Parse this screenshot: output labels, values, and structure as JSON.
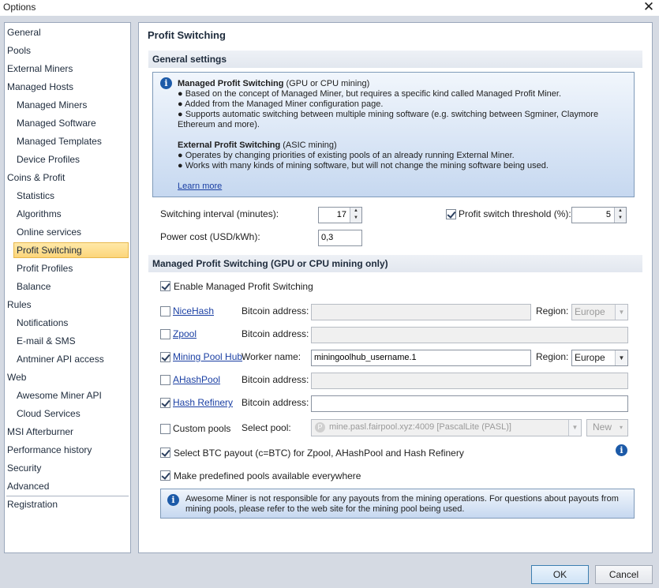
{
  "window": {
    "title": "Options",
    "close_glyph": "✕"
  },
  "sidebar": {
    "items": [
      {
        "label": "General"
      },
      {
        "label": "Pools"
      },
      {
        "label": "External Miners"
      },
      {
        "label": "Managed Hosts"
      },
      {
        "label": "Managed Miners"
      },
      {
        "label": "Managed Software"
      },
      {
        "label": "Managed Templates"
      },
      {
        "label": "Device Profiles"
      },
      {
        "label": "Coins & Profit"
      },
      {
        "label": "Statistics"
      },
      {
        "label": "Algorithms"
      },
      {
        "label": "Online services"
      },
      {
        "label": "Profit Switching",
        "selected": true
      },
      {
        "label": "Profit Profiles"
      },
      {
        "label": "Balance"
      },
      {
        "label": "Rules"
      },
      {
        "label": "Notifications"
      },
      {
        "label": "E-mail & SMS"
      },
      {
        "label": "Antminer API access"
      },
      {
        "label": "Web"
      },
      {
        "label": "Awesome Miner API"
      },
      {
        "label": "Cloud Services"
      },
      {
        "label": "MSI Afterburner"
      },
      {
        "label": "Performance history"
      },
      {
        "label": "Security"
      },
      {
        "label": "Advanced"
      },
      {
        "label": "Registration"
      }
    ]
  },
  "main": {
    "page_title": "Profit Switching",
    "general_section": "General settings",
    "info": {
      "managed_title": "Managed Profit Switching",
      "managed_suffix": " (GPU or CPU mining)",
      "managed_lines": [
        "● Based on the concept of Managed Miner, but requires a specific kind called Managed Profit Miner.",
        "● Added from the Managed Miner configuration page.",
        "● Supports automatic switching between multiple mining software (e.g. switching between Sgminer, Claymore",
        "Ethereum and more)."
      ],
      "external_title": "External Profit Switching",
      "external_suffix": " (ASIC mining)",
      "external_lines": [
        "● Operates by changing priorities of existing pools of an already running External Miner.",
        "● Works with many kinds of mining software, but will not change the mining software being used."
      ],
      "learn_more": "Learn more"
    },
    "switching_interval": {
      "label": "Switching interval (minutes):",
      "value": "17"
    },
    "profit_threshold": {
      "label": "Profit switch threshold (%):",
      "value": "5",
      "checked": true
    },
    "power_cost": {
      "label": "Power cost (USD/kWh):",
      "value": "0,3"
    },
    "managed_section": "Managed Profit Switching (GPU or CPU mining only)",
    "enable_managed": {
      "label": "Enable Managed Profit Switching",
      "checked": true
    },
    "pools": [
      {
        "name": "NiceHash",
        "checked": false,
        "field_label": "Bitcoin address:",
        "value": "",
        "region_label": "Region:",
        "region": "Europe",
        "region_enabled": false
      },
      {
        "name": "Zpool",
        "checked": false,
        "field_label": "Bitcoin address:",
        "value": ""
      },
      {
        "name": "Mining Pool Hub",
        "checked": true,
        "field_label": "Worker name:",
        "value": "miningoolhub_username.1",
        "region_label": "Region:",
        "region": "Europe",
        "region_enabled": true
      },
      {
        "name": "AHashPool",
        "checked": false,
        "field_label": "Bitcoin address:",
        "value": ""
      },
      {
        "name": "Hash Refinery",
        "checked": true,
        "field_label": "Bitcoin address:",
        "value": ""
      }
    ],
    "custom_pools": {
      "label": "Custom pools",
      "checked": false,
      "select_label": "Select pool:",
      "selected_pool": "mine.pasl.fairpool.xyz:4009 [PascalLite (PASL)]",
      "new_label": "New"
    },
    "btc_payout": {
      "label": "Select BTC payout (c=BTC) for Zpool, AHashPool and Hash Refinery",
      "checked": true
    },
    "predefined_pools": {
      "label": "Make predefined pools available everywhere",
      "checked": true
    },
    "disclaimer": [
      "Awesome Miner is not responsible for any payouts from the mining operations. For questions about payouts from",
      "mining pools, please refer to the web site for the mining pool being used."
    ]
  },
  "footer": {
    "ok_label": "OK",
    "cancel_label": "Cancel"
  },
  "icons": {
    "info": "info-icon",
    "close": "close-icon",
    "spin": "spinner-arrows-icon",
    "dropdown": "chevron-down-icon"
  },
  "colors": {
    "selection": "#fcd57a",
    "info_box": "#c6d8f0",
    "link": "#1a3fa3"
  }
}
